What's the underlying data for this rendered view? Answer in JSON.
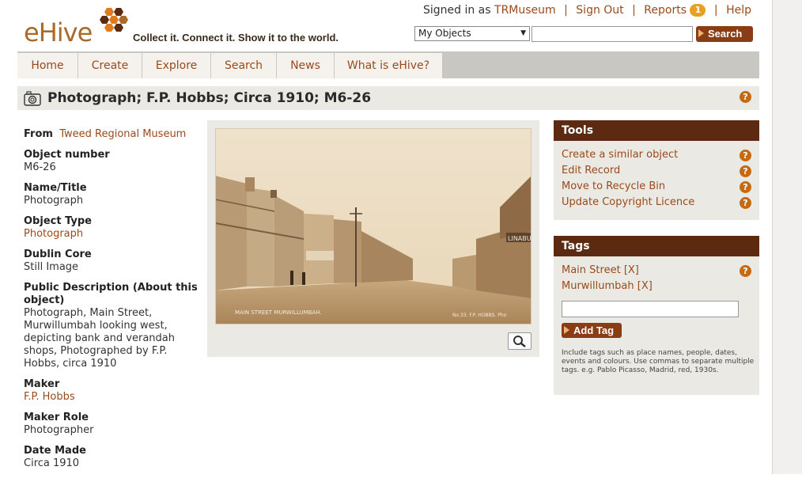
{
  "header": {
    "logo_text": "eHive",
    "tagline": "Collect it. Connect it. Show it to the world.",
    "signed_in_prefix": "Signed in as",
    "username": "TRMuseum",
    "sign_out": "Sign Out",
    "reports": "Reports",
    "reports_count": "1",
    "help": "Help",
    "search_scope": "My Objects",
    "search_value": "",
    "search_button": "Search"
  },
  "menu": {
    "items": [
      "Home",
      "Create",
      "Explore",
      "Search",
      "News",
      "What is eHive?"
    ]
  },
  "title": {
    "text": "Photograph; F.P. Hobbs; Circa 1910; M6-26",
    "help": "?"
  },
  "details": {
    "from_label": "From",
    "from_value": "Tweed Regional Museum",
    "fields": [
      {
        "label": "Object number",
        "value": "M6-26"
      },
      {
        "label": "Name/Title",
        "value": "Photograph"
      },
      {
        "label": "Object Type",
        "value": "Photograph"
      },
      {
        "label": "Dublin Core",
        "value": "Still Image"
      },
      {
        "label": "Public Description (About this object)",
        "value": "Photograph, Main Street, Murwillumbah looking west, depicting bank and verandah shops, Photographed by F.P. Hobbs, circa 1910"
      },
      {
        "label": "Maker",
        "value": "F.P. Hobbs"
      },
      {
        "label": "Maker Role",
        "value": "Photographer"
      },
      {
        "label": "Date Made",
        "value": "Circa 1910"
      }
    ]
  },
  "photo": {
    "caption": "MAIN STREET MURWILLUMBAH.",
    "number": "No.33. F.P. HOBBS. Pho"
  },
  "tools": {
    "heading": "Tools",
    "items": [
      "Create a similar object",
      "Edit Record",
      "Move to Recycle Bin",
      "Update Copyright Licence"
    ],
    "help": "?"
  },
  "tags": {
    "heading": "Tags",
    "items": [
      "Main Street",
      "Murwillumbah"
    ],
    "remove": "[X]",
    "input_value": "",
    "add_button": "Add Tag",
    "hint": "Include tags such as place names, people, dates, events and colours. Use commas to separate multiple tags. e.g. Pablo Picasso, Madrid, red, 1930s.",
    "help": "?"
  },
  "colors": {
    "brand_brown": "#5b2a10",
    "link": "#9a4a1a",
    "panel_bg": "#ebe9e4",
    "help_orange": "#c46a12"
  }
}
